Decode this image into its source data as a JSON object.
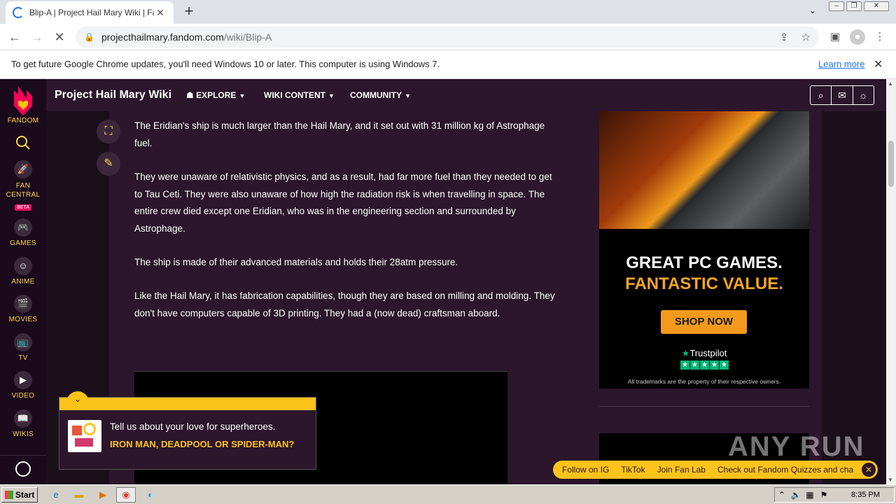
{
  "browser": {
    "tab_title": "Blip-A | Project Hail Mary Wiki | Fand",
    "tab_close": "✕",
    "new_tab": "+",
    "url_host": "projecthailmary.fandom.com",
    "url_path": "/wiki/Blip-A"
  },
  "infobar": {
    "message": "To get future Google Chrome updates, you'll need Windows 10 or later. This computer is using Windows 7.",
    "learn_more": "Learn more",
    "close": "✕"
  },
  "rail": {
    "brand": "FANDOM",
    "items": [
      {
        "label": "FAN CENTRAL",
        "badge": "BETA"
      },
      {
        "label": "GAMES"
      },
      {
        "label": "ANIME"
      },
      {
        "label": "MOVIES"
      },
      {
        "label": "TV"
      },
      {
        "label": "VIDEO"
      },
      {
        "label": "WIKIS"
      }
    ]
  },
  "wiki": {
    "title": "Project Hail Mary Wiki",
    "nav": [
      "EXPLORE",
      "WIKI CONTENT",
      "COMMUNITY"
    ]
  },
  "article": {
    "paragraphs": [
      "The Eridian's ship is much larger than the Hail Mary, and it set out with 31 million kg of Astrophage fuel.",
      "They were unaware of relativistic physics, and as a result, had far more fuel than they needed to get to Tau Ceti. They were also unaware of how high the radiation risk is when travelling in space. The entire crew died except one Eridian, who was in the engineering section and surrounded by Astrophage.",
      "The ship is made of their advanced materials and holds their 28atm pressure.",
      "Like the Hail Mary, it has fabrication capabilities, though they are based on milling and molding. They don't have computers capable of 3D printing. They had a (now dead) craftsman aboard."
    ]
  },
  "ad": {
    "headline1": "GREAT PC GAMES.",
    "headline2": "FANTASTIC VALUE.",
    "button": "SHOP NOW",
    "trustpilot": "Trustpilot",
    "disclaimer": "All trademarks are the property of their respective owners."
  },
  "prompt": {
    "question": "Tell us about your love for superheroes.",
    "link": "IRON MAN, DEADPOOL OR SPIDER-MAN?"
  },
  "followbar": {
    "items": [
      "Follow on IG",
      "TikTok",
      "Join Fan Lab",
      "Check out Fandom Quizzes and cha"
    ],
    "close": "✕"
  },
  "watermark": "ANY RUN",
  "taskbar": {
    "start": "Start",
    "clock": "8:35 PM"
  },
  "colors": {
    "accent": "#fcc31b",
    "page_bg": "#2b162b",
    "ad_orange": "#f39a1d"
  }
}
